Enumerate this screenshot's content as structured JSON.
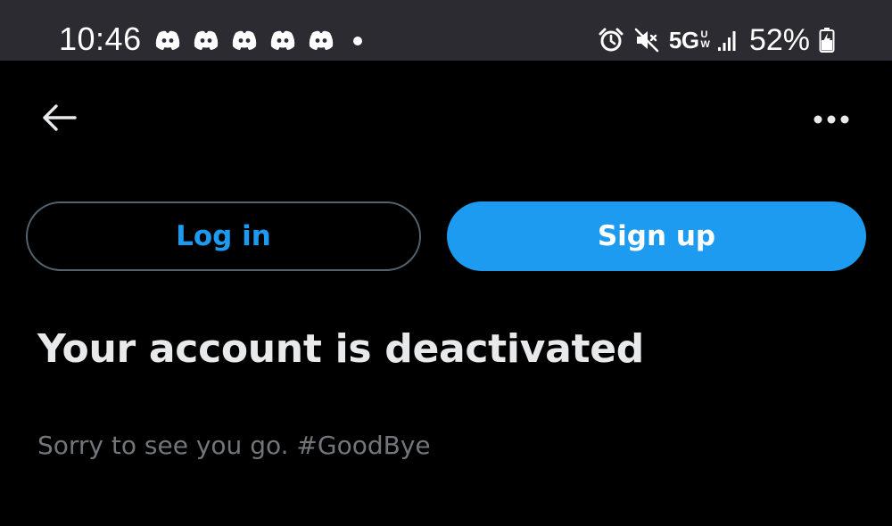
{
  "status_bar": {
    "time": "10:46",
    "notification_icons": [
      "discord-icon",
      "discord-icon",
      "discord-icon",
      "discord-icon",
      "discord-icon"
    ],
    "more_notifications_icon": "dot-icon",
    "system_icons": [
      "alarm-icon",
      "vibrate-mute-icon"
    ],
    "network": "5G",
    "network_badge": [
      "U",
      "W"
    ],
    "signal_icon": "signal-bars-icon",
    "battery_percent": "52%",
    "battery_icon": "battery-charging-icon"
  },
  "nav": {
    "back_icon": "arrow-left-icon",
    "more_icon": "more-horizontal-icon"
  },
  "actions": {
    "login_label": "Log in",
    "signup_label": "Sign up"
  },
  "content": {
    "headline": "Your account is deactivated",
    "message": "Sorry to see you go. #GoodBye"
  },
  "colors": {
    "background": "#000000",
    "status_bar_bg": "#2b2b31",
    "accent": "#1d9bf0",
    "primary_text": "#e7e9ea",
    "secondary_text": "#71767b",
    "outline": "#536471"
  }
}
